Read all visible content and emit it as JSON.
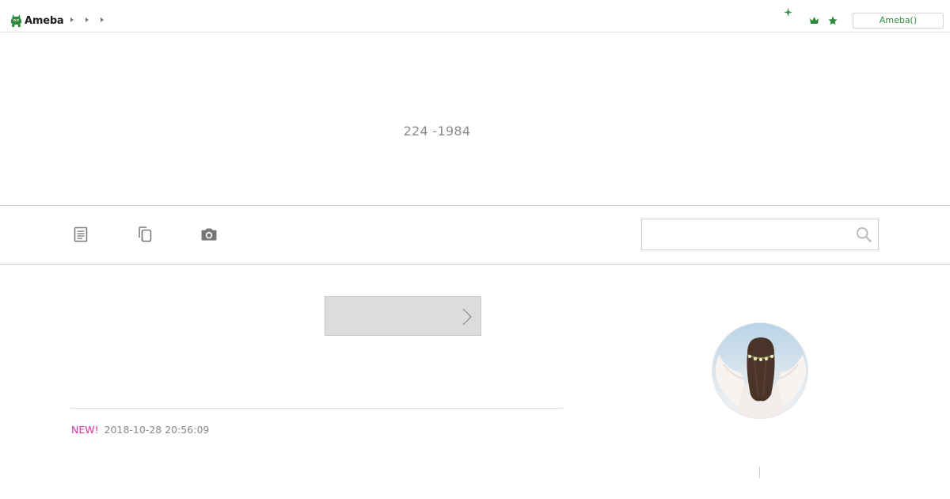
{
  "topbar": {
    "logo": {
      "text": "Ameba",
      "icon": "ameba-logo-icon"
    },
    "breadcrumb_arrows": 3,
    "icons": [
      "sparkle-icon",
      "crown-icon",
      "star-icon"
    ],
    "account_button": "Ameba()"
  },
  "header": {
    "blog_title": "224 -1984"
  },
  "nav": {
    "icons": [
      "article-list-icon",
      "themes-icon",
      "camera-icon"
    ],
    "search": {
      "placeholder": "",
      "value": "",
      "button_icon": "search-icon"
    }
  },
  "main": {
    "more_button": {
      "label": "",
      "icon": "chevron-right-icon"
    },
    "entry": {
      "new_label": "NEW!",
      "date": "2018-10-28 20:56:09"
    }
  },
  "sidebar": {
    "avatar": "profile-avatar"
  },
  "colors": {
    "brand_green": "#2d8a3a",
    "new_pink": "#d0349a",
    "muted_text": "#8a8a8a",
    "border": "#cfcfcf"
  }
}
